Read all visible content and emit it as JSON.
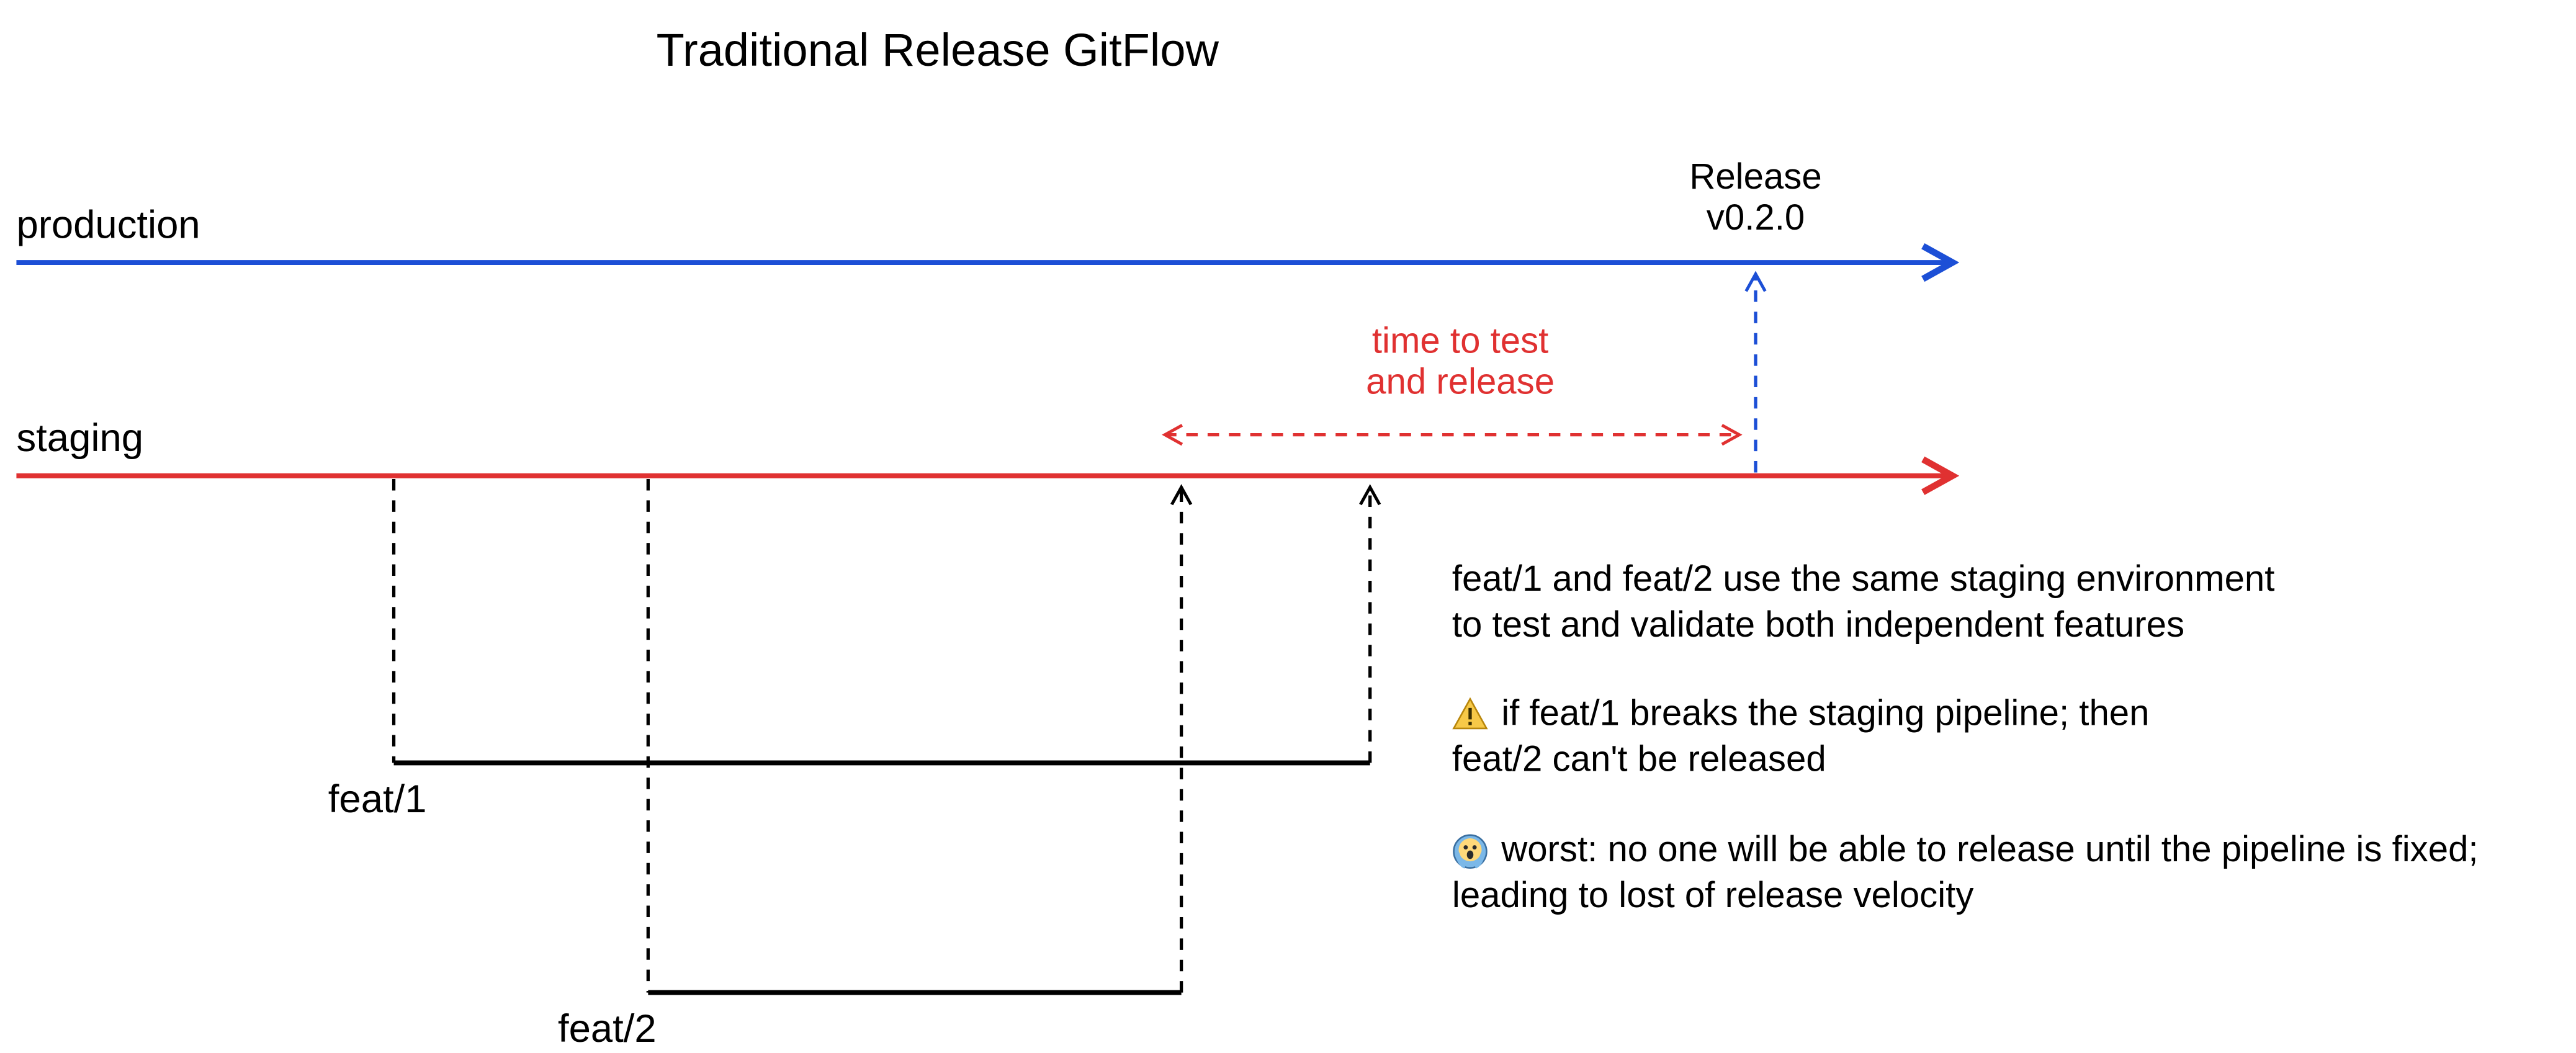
{
  "title": "Traditional Release GitFlow",
  "lanes": {
    "production": "production",
    "staging": "staging"
  },
  "branches": {
    "feat1": "feat/1",
    "feat2": "feat/2"
  },
  "release": {
    "line1": "Release",
    "line2": "v0.2.0"
  },
  "time_to_test": {
    "line1": "time to test",
    "line2": "and release"
  },
  "notes": {
    "p1_line1": "feat/1 and feat/2 use the same staging environment",
    "p1_line2": "to test and validate both independent features",
    "p2_line1": "if feat/1 breaks the staging pipeline; then",
    "p2_line2": "feat/2 can't be released",
    "p3_line1": "worst: no one will be able to release until the pipeline is fixed;",
    "p3_line2": "leading to lost of release velocity"
  },
  "icons": {
    "warning": "warning-icon",
    "scream": "scream-icon"
  },
  "colors": {
    "production": "#1c4fd6",
    "staging": "#e03131",
    "feature": "#000000",
    "note": "#000000"
  }
}
